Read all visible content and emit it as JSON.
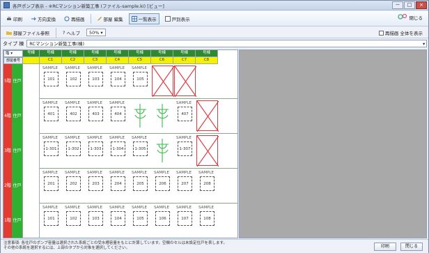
{
  "window": {
    "title": "各戸ポンプ表示 - ※RCマンション新築工事 (ファイル-sample.ki) [ビュー]",
    "buttons": [
      "－",
      "□",
      "×"
    ]
  },
  "toolbar1": {
    "items": [
      {
        "icon": "print-icon",
        "label": "印刷"
      },
      {
        "icon": "arrow-icon",
        "label": "方向変換"
      },
      {
        "icon": "refresh-icon",
        "label": "再描画"
      },
      {
        "icon": "edit-icon",
        "label": "部屋 編集"
      },
      {
        "icon": "grid-icon",
        "label": "一覧表示",
        "active": true
      },
      {
        "icon": "square-icon",
        "label": "戸別表示"
      }
    ],
    "right_label": "閉じる"
  },
  "toolbar2": {
    "items": [
      {
        "icon": "folder-icon",
        "label": "部屋ファイル参照"
      },
      {
        "icon": "help-icon",
        "label": "ヘルプ"
      }
    ],
    "zoom_value": "50%",
    "right_label": "再描画 全体を表示"
  },
  "typerow": {
    "label": "タイプ 棟",
    "value": "RCマンション新築工事(棟)"
  },
  "grid": {
    "corner_select": "階",
    "corner_sub": "部屋番号",
    "header_top": [
      "号棟",
      "号棟",
      "号棟",
      "号棟",
      "号棟",
      "号棟",
      "号棟",
      "号棟",
      "号棟"
    ],
    "header_sub": [
      "",
      "C1",
      "C2",
      "C3",
      "C4",
      "C5",
      "C6",
      "C7",
      "C8"
    ],
    "floors": [
      {
        "red": "5階",
        "green": "住戸",
        "cells": [
          "S",
          "S",
          "S",
          "S",
          "S",
          "E",
          "E"
        ]
      },
      {
        "red": "4階",
        "green": "住戸",
        "cells": [
          "S",
          "S",
          "S",
          "S",
          "G",
          "G",
          "S",
          "E"
        ]
      },
      {
        "red": "3階",
        "green": "住戸",
        "cells": [
          "S",
          "S",
          "S",
          "S",
          "S",
          "G",
          "S",
          "E"
        ]
      },
      {
        "red": "2階",
        "green": "住戸",
        "cells": [
          "S",
          "S",
          "S",
          "S",
          "S",
          "S",
          "S",
          "S"
        ]
      },
      {
        "red": "1階",
        "green": "住戸",
        "cells": [
          "S",
          "S",
          "S",
          "S",
          "S",
          "S",
          "S",
          "S"
        ]
      }
    ],
    "sample_text": "SAMPLE",
    "cell_values": [
      [
        "101",
        "102",
        "103",
        "104",
        "105",
        "",
        ""
      ],
      [
        "401",
        "402",
        "403",
        "404",
        "",
        "",
        "407",
        ""
      ],
      [
        "1-301",
        "1-302",
        "1-303",
        "1-304",
        "1-305",
        "",
        "1-307",
        ""
      ],
      [
        "201",
        "202",
        "203",
        "204",
        "205",
        "206",
        "207",
        "208"
      ],
      [
        "101",
        "102",
        "103",
        "104",
        "105",
        "106",
        "107",
        "108"
      ]
    ]
  },
  "status": {
    "line1": "注意事項: 各住戸のポンプ容量は選択された系統ごとの受水槽容量をもとに計算しています。空欄のセルは未設定住戸を表します。",
    "line2": "その他の系統を選択するには、上部のタブから対象を選択してください。",
    "ok_label": "印刷",
    "cancel_label": "閉じる"
  }
}
